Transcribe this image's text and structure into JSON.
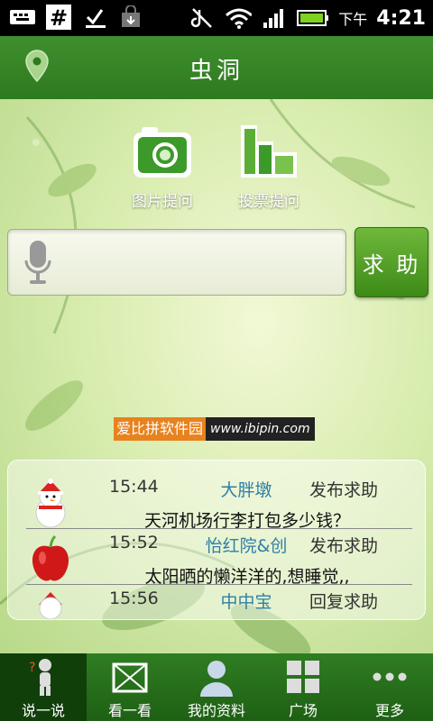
{
  "status_bar": {
    "ampm": "下午",
    "time": "4:21"
  },
  "header": {
    "title": "虫洞"
  },
  "features": [
    {
      "label": "图片提问",
      "icon": "camera-icon"
    },
    {
      "label": "投票提问",
      "icon": "bar-chart-icon"
    }
  ],
  "search": {
    "value": "",
    "placeholder": "",
    "button_label": "求 助"
  },
  "watermark": {
    "cn": "爱比拼软件园",
    "url": "www.ibipin.com"
  },
  "feed": [
    {
      "time": "15:44",
      "user": "大胖墩",
      "action": "发布求助",
      "message": "天河机场行李打包多少钱？",
      "avatar": "snowman-avatar"
    },
    {
      "time": "15:52",
      "user": "怡红院&创",
      "action": "发布求助",
      "message": "太阳晒的懒洋洋的,想睡觉,,",
      "avatar": "apple-avatar"
    },
    {
      "time": "15:56",
      "user": "中中宝",
      "action": "回复求助",
      "message": "",
      "avatar": "snowman-avatar"
    }
  ],
  "nav": [
    {
      "label": "说一说",
      "icon": "talk-icon",
      "active": true
    },
    {
      "label": "看一看",
      "icon": "envelope-icon"
    },
    {
      "label": "我的资料",
      "icon": "profile-icon"
    },
    {
      "label": "广场",
      "icon": "grid-icon"
    },
    {
      "label": "更多",
      "icon": "more-icon"
    }
  ],
  "colors": {
    "brand_green": "#2d7a1f",
    "user_name": "#2e7fa6",
    "watermark_orange": "#e8821e"
  }
}
